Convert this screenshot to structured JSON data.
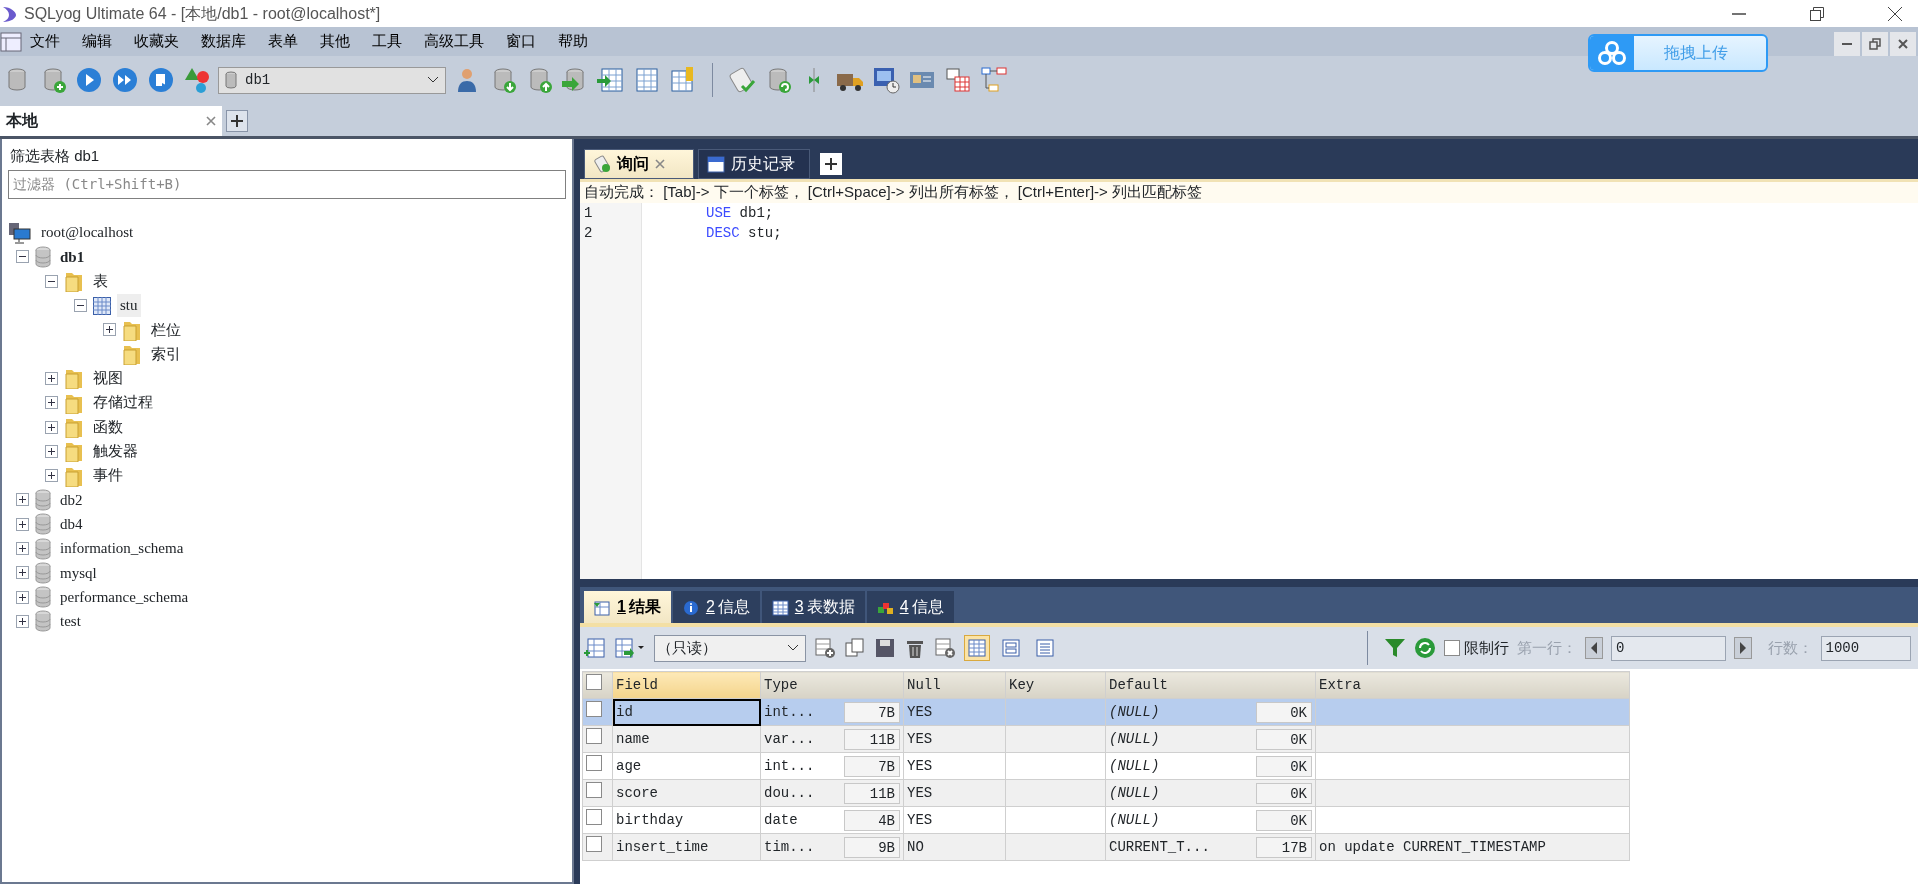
{
  "window": {
    "title": "SQLyog Ultimate 64 - [本地/db1 - root@localhost*]"
  },
  "menu": [
    "文件",
    "编辑",
    "收藏夹",
    "数据库",
    "表单",
    "其他",
    "工具",
    "高级工具",
    "窗口",
    "帮助"
  ],
  "database_select": {
    "value": "db1"
  },
  "upload_button": {
    "label": "拖拽上传"
  },
  "connection_tabs": [
    {
      "label": "本地",
      "selected": true
    }
  ],
  "sidebar": {
    "filter_label": "筛选表格  db1",
    "filter_placeholder": "过滤器 (Ctrl+Shift+B)",
    "tree": [
      {
        "label": "root@localhost",
        "kind": "server",
        "selected": false,
        "children": [
          {
            "label": "db1",
            "kind": "database",
            "current": true,
            "expanded": true,
            "selected": false,
            "children": [
              {
                "label": "表",
                "kind": "folder",
                "expanded": true,
                "selected": false,
                "children": [
                  {
                    "label": "stu",
                    "kind": "table",
                    "expanded": true,
                    "selected": true,
                    "children": [
                      {
                        "label": "栏位",
                        "kind": "folder",
                        "expanded": false,
                        "selected": false
                      },
                      {
                        "label": "索引",
                        "kind": "folder",
                        "selected": false
                      }
                    ]
                  }
                ]
              },
              {
                "label": "视图",
                "kind": "folder",
                "expanded": false,
                "selected": false
              },
              {
                "label": "存储过程",
                "kind": "folder",
                "expanded": false,
                "selected": false
              },
              {
                "label": "函数",
                "kind": "folder",
                "expanded": false,
                "selected": false
              },
              {
                "label": "触发器",
                "kind": "folder",
                "expanded": false,
                "selected": false
              },
              {
                "label": "事件",
                "kind": "folder",
                "expanded": false,
                "selected": false
              }
            ]
          },
          {
            "label": "db2",
            "kind": "database",
            "current": false,
            "expanded": false,
            "selected": false
          },
          {
            "label": "db4",
            "kind": "database",
            "current": false,
            "expanded": false,
            "selected": false
          },
          {
            "label": "information_schema",
            "kind": "database",
            "current": false,
            "expanded": false,
            "selected": false
          },
          {
            "label": "mysql",
            "kind": "database",
            "current": false,
            "expanded": false,
            "selected": false
          },
          {
            "label": "performance_schema",
            "kind": "database",
            "current": false,
            "expanded": false,
            "selected": false
          },
          {
            "label": "test",
            "kind": "database",
            "current": false,
            "expanded": false,
            "selected": false
          }
        ]
      }
    ]
  },
  "query_tabs": [
    {
      "label": "询问",
      "kind": "query",
      "selected": true
    },
    {
      "label": "历史记录",
      "kind": "history",
      "selected": false
    }
  ],
  "autocomplete_hint": "自动完成： [Tab]-> 下一个标签， [Ctrl+Space]-> 列出所有标签， [Ctrl+Enter]-> 列出匹配标签",
  "editor_lines": [
    {
      "number": "1",
      "tokens": [
        {
          "text": "USE",
          "kind": "keyword"
        },
        {
          "text": " db1;",
          "kind": "plain"
        }
      ]
    },
    {
      "number": "2",
      "tokens": [
        {
          "text": "DESC",
          "kind": "keyword"
        },
        {
          "text": " stu;",
          "kind": "plain"
        }
      ]
    }
  ],
  "result_tabs": [
    {
      "number": "1",
      "label": "结果",
      "kind": "result",
      "selected": true
    },
    {
      "number": "2",
      "label": "信息",
      "kind": "info",
      "selected": false
    },
    {
      "number": "3",
      "label": "表数据",
      "kind": "table",
      "selected": false
    },
    {
      "number": "4",
      "label": "信息",
      "kind": "profile",
      "selected": false
    }
  ],
  "result_toolbar": {
    "mode_select": "（只读）",
    "view_modes": [
      {
        "selected": true
      },
      {
        "selected": false
      },
      {
        "selected": false
      }
    ],
    "limit_label": "限制行",
    "limit_checked": false,
    "first_row_label": "第一行：",
    "first_row": "0",
    "row_count_label": "行数：",
    "row_count": "1000"
  },
  "table": {
    "select_all_checked": false,
    "columns": [
      {
        "label": "Field",
        "selected": true
      },
      {
        "label": "Type",
        "selected": false
      },
      {
        "label": "Null",
        "selected": false
      },
      {
        "label": "Key",
        "selected": false
      },
      {
        "label": "Default",
        "selected": false
      },
      {
        "label": "Extra",
        "selected": false
      }
    ],
    "rows": [
      {
        "checked": false,
        "selected": true,
        "field": "id",
        "type": "int...",
        "type_size": "7B",
        "null": "YES",
        "default": "(NULL)",
        "default_null": true,
        "default_size": "0K"
      },
      {
        "checked": false,
        "selected": false,
        "field": "name",
        "type": "var...",
        "type_size": "11B",
        "null": "YES",
        "default": "(NULL)",
        "default_null": true,
        "default_size": "0K"
      },
      {
        "checked": false,
        "selected": false,
        "field": "age",
        "type": "int...",
        "type_size": "7B",
        "null": "YES",
        "default": "(NULL)",
        "default_null": true,
        "default_size": "0K"
      },
      {
        "checked": false,
        "selected": false,
        "field": "score",
        "type": "dou...",
        "type_size": "11B",
        "null": "YES",
        "default": "(NULL)",
        "default_null": true,
        "default_size": "0K"
      },
      {
        "checked": false,
        "selected": false,
        "field": "birthday",
        "type": "date",
        "type_size": "4B",
        "null": "YES",
        "default": "(NULL)",
        "default_null": true,
        "default_size": "0K"
      },
      {
        "checked": false,
        "selected": false,
        "field": "insert_time",
        "type": "tim...",
        "type_size": "9B",
        "null": "NO",
        "default": "CURRENT_T...",
        "default_null": false,
        "default_size": "17B",
        "extra": "on update CURRENT_TIMESTAMP"
      }
    ]
  }
}
